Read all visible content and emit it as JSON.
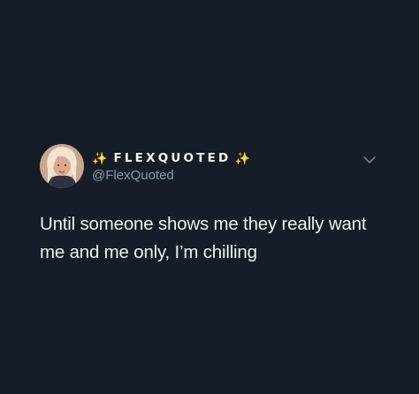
{
  "tweet": {
    "display_name_prefix": "✨",
    "display_name": "FLEXQUOTED",
    "display_name_suffix": "✨",
    "handle": "@FlexQuoted",
    "text": "Until someone shows me they really want me and me only, I’m chilling",
    "avatar_icon": "profile-photo",
    "menu_icon": "chevron-down-icon"
  },
  "colors": {
    "background": "#161d29",
    "text": "#eef1f4",
    "secondary_text": "#8b98a5",
    "sparkle": "#f5c84c"
  }
}
